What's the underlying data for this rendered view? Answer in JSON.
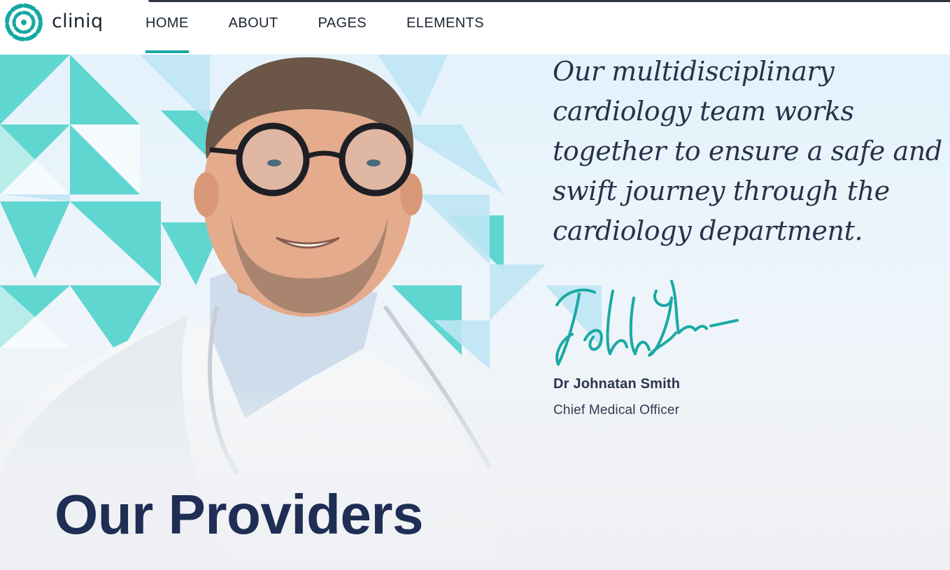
{
  "brand": {
    "name": "cliniq",
    "logo_icon": "cliniq-ring-logo",
    "accent_color": "#18a9a5"
  },
  "nav": {
    "items": [
      {
        "label": "HOME",
        "active": true
      },
      {
        "label": "ABOUT",
        "active": false
      },
      {
        "label": "PAGES",
        "active": false
      },
      {
        "label": "ELEMENTS",
        "active": false
      }
    ]
  },
  "hero": {
    "quote": "Our multidisciplinary cardiology team works together to ensure a safe and swift journey through the cardiology department.",
    "signature_text": "John Smith",
    "doctor_name": "Dr Johnatan Smith",
    "doctor_role": "Chief Medical Officer",
    "photo_subject": "doctor-portrait"
  },
  "section": {
    "title": "Our Providers"
  },
  "colors": {
    "heading": "#1e2e55",
    "pattern_teal": "#5fd6d0",
    "pattern_light": "#bfe6f5",
    "signature": "#1aa9a4"
  }
}
